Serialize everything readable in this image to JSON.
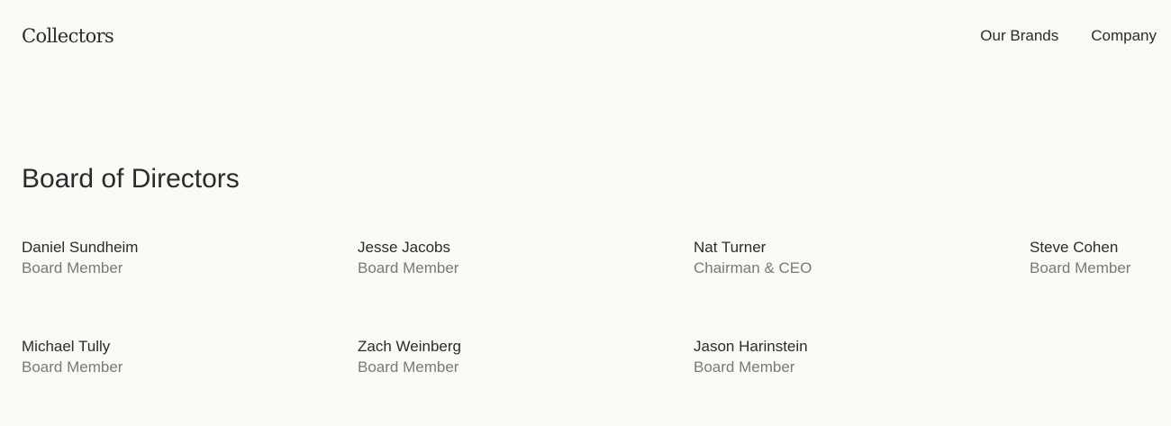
{
  "header": {
    "logo": "Collectors",
    "nav": [
      {
        "label": "Our Brands"
      },
      {
        "label": "Company"
      }
    ]
  },
  "board": {
    "title": "Board of Directors",
    "members": [
      {
        "name": "Daniel Sundheim",
        "role": "Board Member"
      },
      {
        "name": "Jesse Jacobs",
        "role": "Board Member"
      },
      {
        "name": "Nat Turner",
        "role": "Chairman & CEO"
      },
      {
        "name": "Steve Cohen",
        "role": "Board Member"
      },
      {
        "name": "Michael Tully",
        "role": "Board Member"
      },
      {
        "name": "Zach Weinberg",
        "role": "Board Member"
      },
      {
        "name": "Jason Harinstein",
        "role": "Board Member"
      }
    ]
  },
  "colors": {
    "background": "#f9f9f5",
    "text": "#2b2b2b",
    "muted": "#7a7a75"
  }
}
